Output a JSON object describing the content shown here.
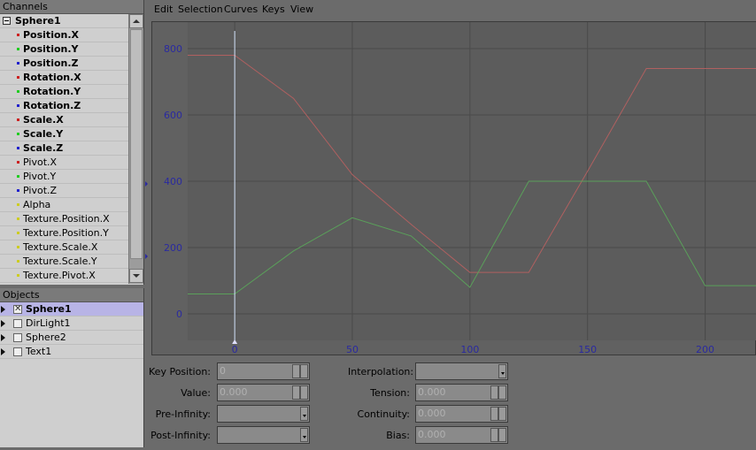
{
  "channels_panel": {
    "title": "Channels",
    "root": "Sphere1",
    "items": [
      {
        "label": "Position.X",
        "color": "#cc2222",
        "bold": true
      },
      {
        "label": "Position.Y",
        "color": "#22cc22",
        "bold": true
      },
      {
        "label": "Position.Z",
        "color": "#2222cc",
        "bold": true
      },
      {
        "label": "Rotation.X",
        "color": "#cc2222",
        "bold": true
      },
      {
        "label": "Rotation.Y",
        "color": "#22cc22",
        "bold": true
      },
      {
        "label": "Rotation.Z",
        "color": "#2222cc",
        "bold": true
      },
      {
        "label": "Scale.X",
        "color": "#cc2222",
        "bold": true
      },
      {
        "label": "Scale.Y",
        "color": "#22cc22",
        "bold": true
      },
      {
        "label": "Scale.Z",
        "color": "#2222cc",
        "bold": true
      },
      {
        "label": "Pivot.X",
        "color": "#cc2222",
        "bold": false
      },
      {
        "label": "Pivot.Y",
        "color": "#22cc22",
        "bold": false
      },
      {
        "label": "Pivot.Z",
        "color": "#2222cc",
        "bold": false
      },
      {
        "label": "Alpha",
        "color": "#cccc22",
        "bold": false
      },
      {
        "label": "Texture.Position.X",
        "color": "#cccc22",
        "bold": false
      },
      {
        "label": "Texture.Position.Y",
        "color": "#cccc22",
        "bold": false
      },
      {
        "label": "Texture.Scale.X",
        "color": "#cccc22",
        "bold": false
      },
      {
        "label": "Texture.Scale.Y",
        "color": "#cccc22",
        "bold": false
      },
      {
        "label": "Texture.Pivot.X",
        "color": "#cccc22",
        "bold": false
      }
    ]
  },
  "objects_panel": {
    "title": "Objects",
    "items": [
      {
        "label": "Sphere1",
        "checked": true,
        "selected": true
      },
      {
        "label": "DirLight1",
        "checked": false,
        "selected": false
      },
      {
        "label": "Sphere2",
        "checked": false,
        "selected": false
      },
      {
        "label": "Text1",
        "checked": false,
        "selected": false
      }
    ]
  },
  "menu": [
    "Edit",
    "Selection",
    "Curves",
    "Keys",
    "View"
  ],
  "chart_data": {
    "type": "line",
    "x_ticks": [
      0,
      50,
      100,
      150,
      200
    ],
    "y_ticks": [
      0,
      200,
      400,
      600,
      800
    ],
    "xlim": [
      -20,
      222
    ],
    "ylim": [
      -80,
      880
    ],
    "playhead": 0,
    "grid": true,
    "series": [
      {
        "color": "#b06060",
        "points": [
          [
            -20,
            780
          ],
          [
            0,
            780
          ],
          [
            25,
            650
          ],
          [
            50,
            420
          ],
          [
            75,
            270
          ],
          [
            100,
            125
          ],
          [
            125,
            125
          ],
          [
            150,
            430
          ],
          [
            175,
            740
          ],
          [
            222,
            740
          ]
        ]
      },
      {
        "color": "#5aa05a",
        "points": [
          [
            -20,
            60
          ],
          [
            0,
            60
          ],
          [
            25,
            190
          ],
          [
            50,
            290
          ],
          [
            75,
            235
          ],
          [
            100,
            80
          ],
          [
            125,
            400
          ],
          [
            150,
            400
          ],
          [
            175,
            400
          ],
          [
            200,
            85
          ],
          [
            222,
            85
          ]
        ]
      }
    ]
  },
  "props": {
    "key_position_label": "Key Position:",
    "key_position_value": "0",
    "value_label": "Value:",
    "value_value": "0.000",
    "pre_infinity_label": "Pre-Infinity:",
    "post_infinity_label": "Post-Infinity:",
    "interpolation_label": "Interpolation:",
    "tension_label": "Tension:",
    "tension_value": "0.000",
    "continuity_label": "Continuity:",
    "continuity_value": "0.000",
    "bias_label": "Bias:",
    "bias_value": "0.000"
  }
}
